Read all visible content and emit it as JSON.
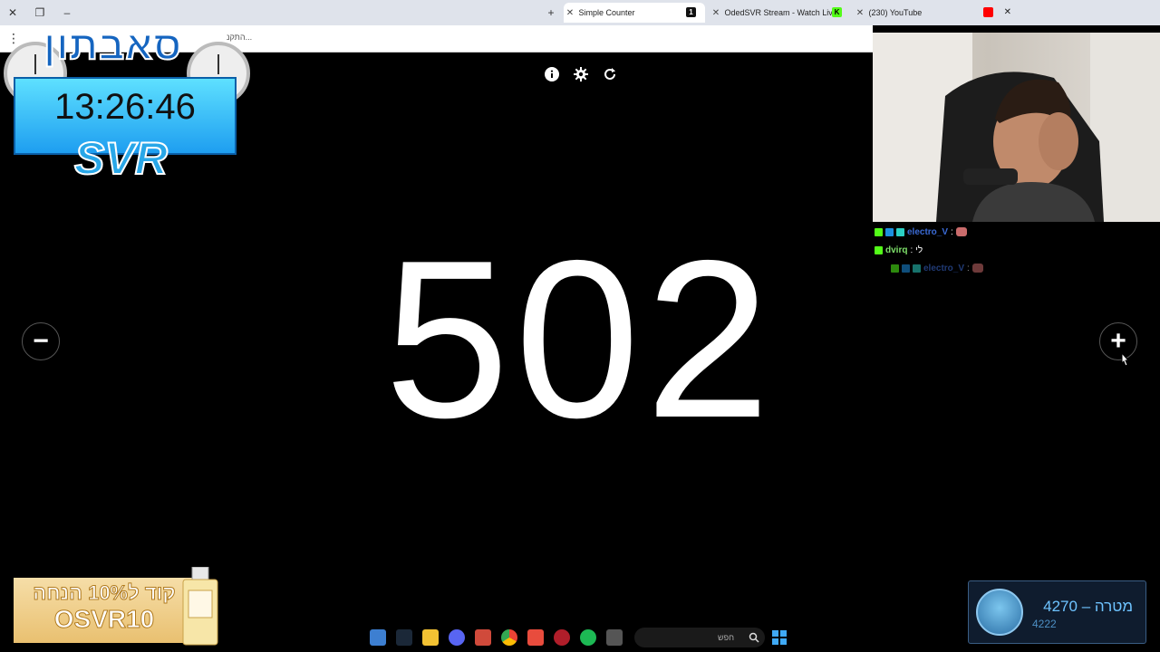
{
  "browser": {
    "tabs": [
      {
        "title": "Simple Counter",
        "active": true,
        "favicon_text": "1"
      },
      {
        "title": "OdedSVR Stream - Watch Live",
        "active": false,
        "favicon_text": "K"
      },
      {
        "title": "(230) YouTube",
        "active": false,
        "favicon_text": ""
      }
    ],
    "new_tab_label": "+",
    "toolbar_hint": "התקנ..."
  },
  "counter": {
    "value": "502",
    "decrement_label": "−",
    "increment_label": "+",
    "icons": [
      "info-icon",
      "gear-icon",
      "refresh-icon"
    ]
  },
  "overlay": {
    "logo": "סאבתון",
    "timer": "13:26:46",
    "brand": "SVR"
  },
  "chat": [
    {
      "user": "electro_V",
      "message": "",
      "user_color": "#3b6bd6",
      "has_emote": true
    },
    {
      "user": "dvirq",
      "message": "לי",
      "user_color": "#7ee06a",
      "has_emote": false
    },
    {
      "user": "electro_V",
      "message": "",
      "user_color": "#3b6bd6",
      "has_emote": true
    }
  ],
  "ad": {
    "line1": "קוד ל10% הנחה",
    "line2": "OSVR10"
  },
  "goal": {
    "label": "מטרה – 4270",
    "current": "4222"
  },
  "taskbar": {
    "search_placeholder": "חפש"
  },
  "colors": {
    "accent_blue": "#29a7e8",
    "youtube_red": "#ff0000",
    "kick_green": "#53fc18"
  }
}
